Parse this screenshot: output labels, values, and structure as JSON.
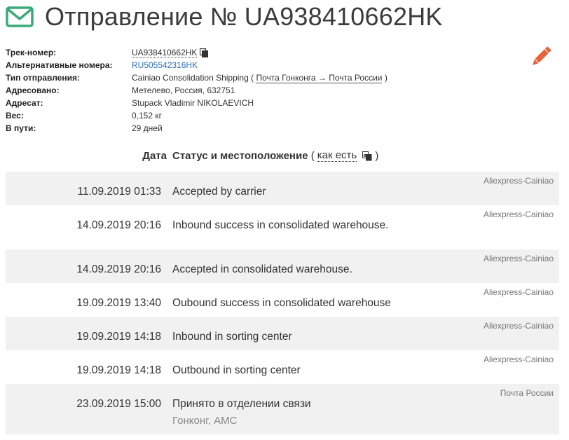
{
  "header": {
    "title": "Отправление № UA938410662HK",
    "icon": "envelope-icon",
    "accent_color": "#3aaa78"
  },
  "info": {
    "rows": [
      {
        "label": "Трек-номер:",
        "value": "UA938410662HK"
      },
      {
        "label": "Альтернативные номера:",
        "value": "RU505542316HK"
      },
      {
        "label": "Тип отправления:",
        "value": "Cainiao Consolidation Shipping",
        "paren_open": "(",
        "route": "Почта Гонконга → Почта России",
        "paren_close": ")"
      },
      {
        "label": "Адресовано:",
        "value": "Метелево, Россия, 632751"
      },
      {
        "label": "Адресат:",
        "value": "Stupack Vladimir NIKOLAEVICH"
      },
      {
        "label": "Вес:",
        "value": "0,152 кг"
      },
      {
        "label": "В пути:",
        "value": "29 дней"
      }
    ],
    "link_color": "#2a6ebb",
    "edit_color": "#e8623a"
  },
  "table": {
    "col_date": "Дата",
    "col_status": "Статус и местоположение",
    "paren_open": "(",
    "as_is_link": "как есть",
    "paren_close": ")"
  },
  "events": [
    {
      "source": "Aliexpress-Cainiao",
      "date": "11.09.2019 01:33",
      "status": "Accepted by carrier",
      "location": ""
    },
    {
      "source": "Aliexpress-Cainiao",
      "date": "14.09.2019 20:16",
      "status": "Inbound success in consolidated warehouse.",
      "location": ""
    },
    {
      "source": "Aliexpress-Cainiao",
      "date": "14.09.2019 20:16",
      "status": "Accepted in consolidated warehouse.",
      "location": ""
    },
    {
      "source": "Aliexpress-Cainiao",
      "date": "19.09.2019 13:40",
      "status": "Oubound success in consolidated warehouse",
      "location": ""
    },
    {
      "source": "Aliexpress-Cainiao",
      "date": "19.09.2019 14:18",
      "status": "Inbound in sorting center",
      "location": ""
    },
    {
      "source": "Aliexpress-Cainiao",
      "date": "19.09.2019 14:18",
      "status": "Outbound in sorting center",
      "location": ""
    },
    {
      "source": "Почта России",
      "date": "23.09.2019 15:00",
      "status": "Принято в отделении связи",
      "location": "Гонконг, АМС"
    }
  ]
}
